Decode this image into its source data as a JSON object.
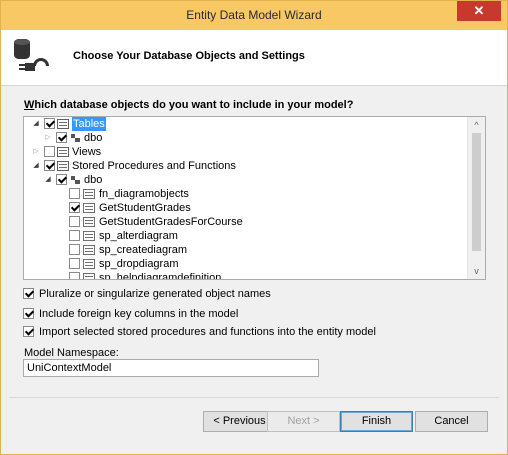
{
  "window": {
    "title": "Entity Data Model Wizard",
    "close_glyph": "✕"
  },
  "header": {
    "heading": "Choose Your Database Objects and Settings",
    "icon": "database-connector-icon"
  },
  "question": "Which database objects do you want to include in your model?",
  "tree": {
    "tables": {
      "label": "Tables",
      "checked": true,
      "expanded": true
    },
    "tables_dbo": {
      "label": "dbo",
      "checked": true,
      "expanded": false
    },
    "views": {
      "label": "Views",
      "checked": false,
      "expanded": false
    },
    "procs": {
      "label": "Stored Procedures and Functions",
      "checked": true,
      "expanded": true
    },
    "procs_dbo": {
      "label": "dbo",
      "checked": true,
      "expanded": true
    },
    "items": [
      {
        "label": "fn_diagramobjects",
        "checked": false
      },
      {
        "label": "GetStudentGrades",
        "checked": true
      },
      {
        "label": "GetStudentGradesForCourse",
        "checked": false
      },
      {
        "label": "sp_alterdiagram",
        "checked": false
      },
      {
        "label": "sp_creatediagram",
        "checked": false
      },
      {
        "label": "sp_dropdiagram",
        "checked": false
      },
      {
        "label": "sp_helpdiagramdefinition",
        "checked": false
      }
    ]
  },
  "options": [
    {
      "label": "Pluralize or singularize generated object names",
      "checked": true
    },
    {
      "label": "Include foreign key columns in the model",
      "checked": true
    },
    {
      "label": "Import selected stored procedures and functions into the entity model",
      "checked": true
    }
  ],
  "namespace": {
    "label": "Model Namespace:",
    "value": "UniContextModel"
  },
  "buttons": {
    "previous": "< Previous",
    "next": "Next >",
    "finish": "Finish",
    "cancel": "Cancel"
  }
}
